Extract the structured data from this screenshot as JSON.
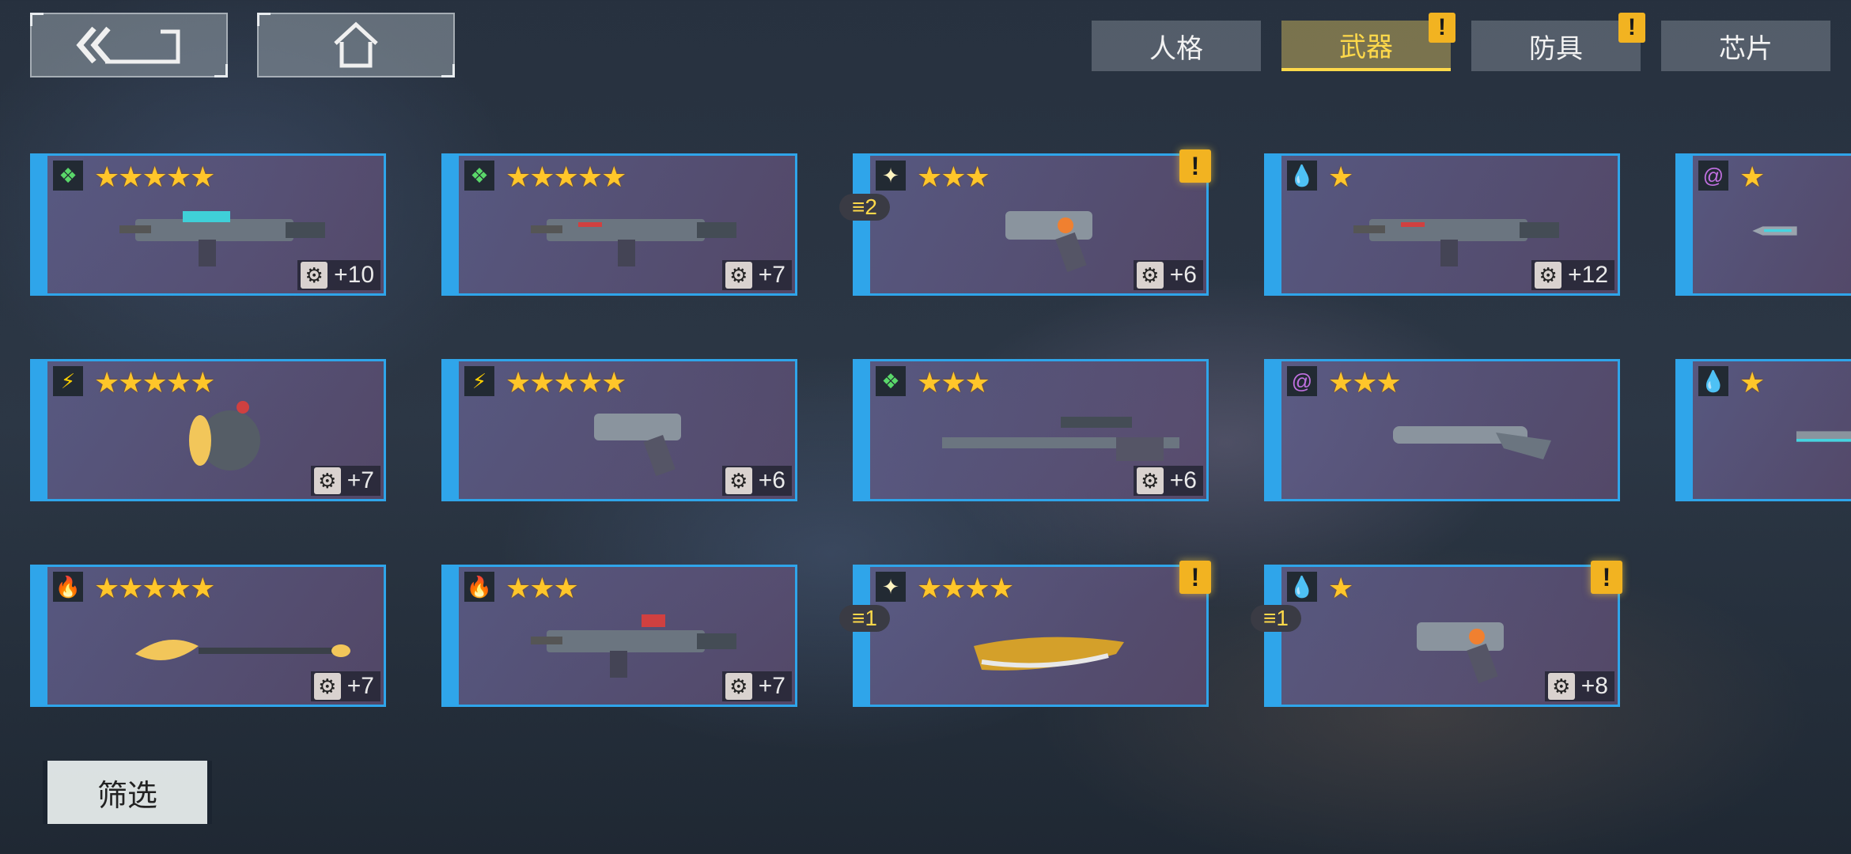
{
  "nav": {
    "back": "back-double-chevron-icon",
    "home": "home-icon"
  },
  "tabs": [
    {
      "label": "人格",
      "active": false,
      "alert": ""
    },
    {
      "label": "武器",
      "active": true,
      "alert": "!"
    },
    {
      "label": "防具",
      "active": false,
      "alert": "!"
    },
    {
      "label": "芯片",
      "active": false,
      "alert": ""
    }
  ],
  "colors": {
    "accent_blue": "#2fa5ea",
    "star_gold": "#ffc62a",
    "alert_gold": "#f2b321"
  },
  "weapons": [
    {
      "element": "wind",
      "elem_glyph": "❖",
      "stars": "★★★★★",
      "level": "+10",
      "warn": "",
      "copies": "",
      "weapon_icon": "assault-rifle-icon"
    },
    {
      "element": "wind",
      "elem_glyph": "❖",
      "stars": "★★★★★",
      "level": "+7",
      "warn": "",
      "copies": "",
      "weapon_icon": "assault-rifle-icon"
    },
    {
      "element": "light",
      "elem_glyph": "✦",
      "stars": "★★★",
      "level": "+6",
      "warn": "!",
      "copies": "≡2",
      "weapon_icon": "pistol-icon"
    },
    {
      "element": "water",
      "elem_glyph": "💧",
      "stars": "★",
      "level": "+12",
      "warn": "",
      "copies": "",
      "weapon_icon": "assault-rifle-icon"
    },
    {
      "element": "poison",
      "elem_glyph": "@",
      "stars": "★",
      "level": "",
      "warn": "",
      "copies": "",
      "weapon_icon": "blade-icon"
    },
    {
      "element": "lightning",
      "elem_glyph": "⚡",
      "stars": "★★★★★",
      "level": "+7",
      "warn": "",
      "copies": "",
      "weapon_icon": "bomb-launcher-icon"
    },
    {
      "element": "lightning",
      "elem_glyph": "⚡",
      "stars": "★★★★★",
      "level": "+6",
      "warn": "",
      "copies": "",
      "weapon_icon": "pistol-icon"
    },
    {
      "element": "wind",
      "elem_glyph": "❖",
      "stars": "★★★",
      "level": "+6",
      "warn": "",
      "copies": "",
      "weapon_icon": "sniper-rifle-icon"
    },
    {
      "element": "poison",
      "elem_glyph": "@",
      "stars": "★★★",
      "level": "",
      "warn": "",
      "copies": "",
      "weapon_icon": "shotgun-icon"
    },
    {
      "element": "water",
      "elem_glyph": "💧",
      "stars": "★",
      "level": "",
      "warn": "",
      "copies": "",
      "weapon_icon": "launcher-icon"
    },
    {
      "element": "fire",
      "elem_glyph": "🔥",
      "stars": "★★★★★",
      "level": "+7",
      "warn": "",
      "copies": "",
      "weapon_icon": "spear-launcher-icon"
    },
    {
      "element": "fire",
      "elem_glyph": "🔥",
      "stars": "★★★",
      "level": "+7",
      "warn": "",
      "copies": "",
      "weapon_icon": "assault-rifle-icon"
    },
    {
      "element": "light",
      "elem_glyph": "✦",
      "stars": "★★★★",
      "level": "",
      "warn": "!",
      "copies": "≡1",
      "weapon_icon": "golden-blade-icon"
    },
    {
      "element": "water",
      "elem_glyph": "💧",
      "stars": "★",
      "level": "+8",
      "warn": "!",
      "copies": "≡1",
      "weapon_icon": "pistol-icon"
    }
  ],
  "filter": {
    "label": "筛选"
  }
}
